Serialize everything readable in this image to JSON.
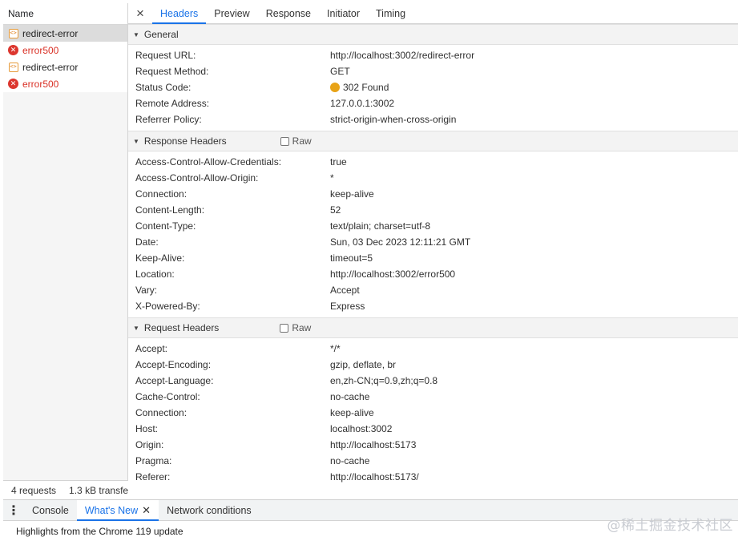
{
  "request_list": {
    "header": "Name",
    "items": [
      {
        "label": "redirect-error",
        "type": "document",
        "selected": true
      },
      {
        "label": "error500",
        "type": "error",
        "selected": false
      },
      {
        "label": "redirect-error",
        "type": "document",
        "selected": false
      },
      {
        "label": "error500",
        "type": "error",
        "selected": false
      }
    ],
    "summary_requests": "4 requests",
    "summary_transfer": "1.3 kB transfe"
  },
  "detail_tabs": {
    "close_icon": "×",
    "tabs": [
      "Headers",
      "Preview",
      "Response",
      "Initiator",
      "Timing"
    ],
    "active": "Headers"
  },
  "general": {
    "title": "General",
    "rows": [
      {
        "key": "Request URL:",
        "value": "http://localhost:3002/redirect-error"
      },
      {
        "key": "Request Method:",
        "value": "GET"
      },
      {
        "key": "Status Code:",
        "value": "302 Found"
      },
      {
        "key": "Remote Address:",
        "value": "127.0.0.1:3002"
      },
      {
        "key": "Referrer Policy:",
        "value": "strict-origin-when-cross-origin"
      }
    ],
    "status_dot_color": "#e8a317"
  },
  "response_headers": {
    "title": "Response Headers",
    "raw_label": "Raw",
    "rows": [
      {
        "key": "Access-Control-Allow-Credentials:",
        "value": "true"
      },
      {
        "key": "Access-Control-Allow-Origin:",
        "value": "*"
      },
      {
        "key": "Connection:",
        "value": "keep-alive"
      },
      {
        "key": "Content-Length:",
        "value": "52"
      },
      {
        "key": "Content-Type:",
        "value": "text/plain; charset=utf-8"
      },
      {
        "key": "Date:",
        "value": "Sun, 03 Dec 2023 12:11:21 GMT"
      },
      {
        "key": "Keep-Alive:",
        "value": "timeout=5"
      },
      {
        "key": "Location:",
        "value": "http://localhost:3002/error500"
      },
      {
        "key": "Vary:",
        "value": "Accept"
      },
      {
        "key": "X-Powered-By:",
        "value": "Express"
      }
    ]
  },
  "request_headers": {
    "title": "Request Headers",
    "raw_label": "Raw",
    "rows": [
      {
        "key": "Accept:",
        "value": "*/*"
      },
      {
        "key": "Accept-Encoding:",
        "value": "gzip, deflate, br"
      },
      {
        "key": "Accept-Language:",
        "value": "en,zh-CN;q=0.9,zh;q=0.8"
      },
      {
        "key": "Cache-Control:",
        "value": "no-cache"
      },
      {
        "key": "Connection:",
        "value": "keep-alive"
      },
      {
        "key": "Host:",
        "value": "localhost:3002"
      },
      {
        "key": "Origin:",
        "value": "http://localhost:5173"
      },
      {
        "key": "Pragma:",
        "value": "no-cache"
      },
      {
        "key": "Referer:",
        "value": "http://localhost:5173/"
      }
    ]
  },
  "drawer": {
    "menu_icon": "⋮",
    "tabs": [
      {
        "label": "Console",
        "active": false
      },
      {
        "label": "What's New",
        "active": true,
        "closable": true
      },
      {
        "label": "Network conditions",
        "active": false
      }
    ],
    "body_text": "Highlights from the Chrome 119 update",
    "watermark": "@稀土掘金技术社区"
  }
}
